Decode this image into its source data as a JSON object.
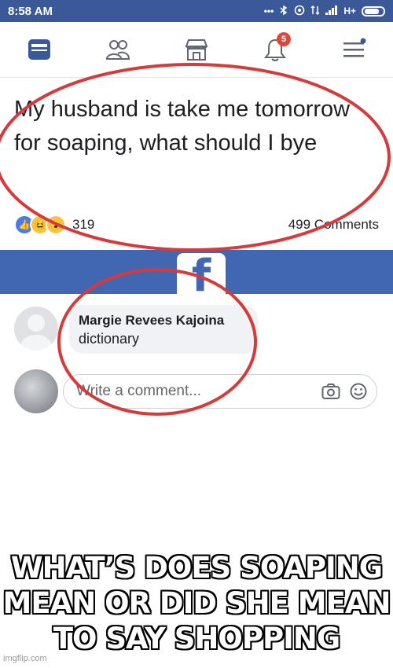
{
  "status_bar": {
    "time": "8:58 AM",
    "icons": [
      "more-dots-icon",
      "bluetooth-icon",
      "data-saver-icon",
      "signal-icon",
      "network-type"
    ],
    "network": "H+"
  },
  "nav": {
    "items": [
      "news-feed-icon",
      "friends-icon",
      "marketplace-icon",
      "notifications-icon",
      "menu-icon"
    ],
    "notification_badge": "5"
  },
  "post": {
    "text": "My husband is take me tomorrow for soaping, what should I bye",
    "reaction_count": "319",
    "comments_count": "499 Comments",
    "reactions": [
      "like-icon",
      "haha-icon",
      "wow-icon"
    ]
  },
  "comment": {
    "author": "Margie Revees Kajoina",
    "text": "dictionary"
  },
  "write_comment": {
    "placeholder": "Write a comment..."
  },
  "caption": "WHAT’S DOES SOAPING MEAN OR DID SHE MEAN TO SAY SHOPPING",
  "watermark": "imgflip.com",
  "colors": {
    "facebook_blue": "#3b5998",
    "band_blue": "#4267b2",
    "circle_red": "#d63a3a",
    "badge_red": "#e0463c"
  }
}
